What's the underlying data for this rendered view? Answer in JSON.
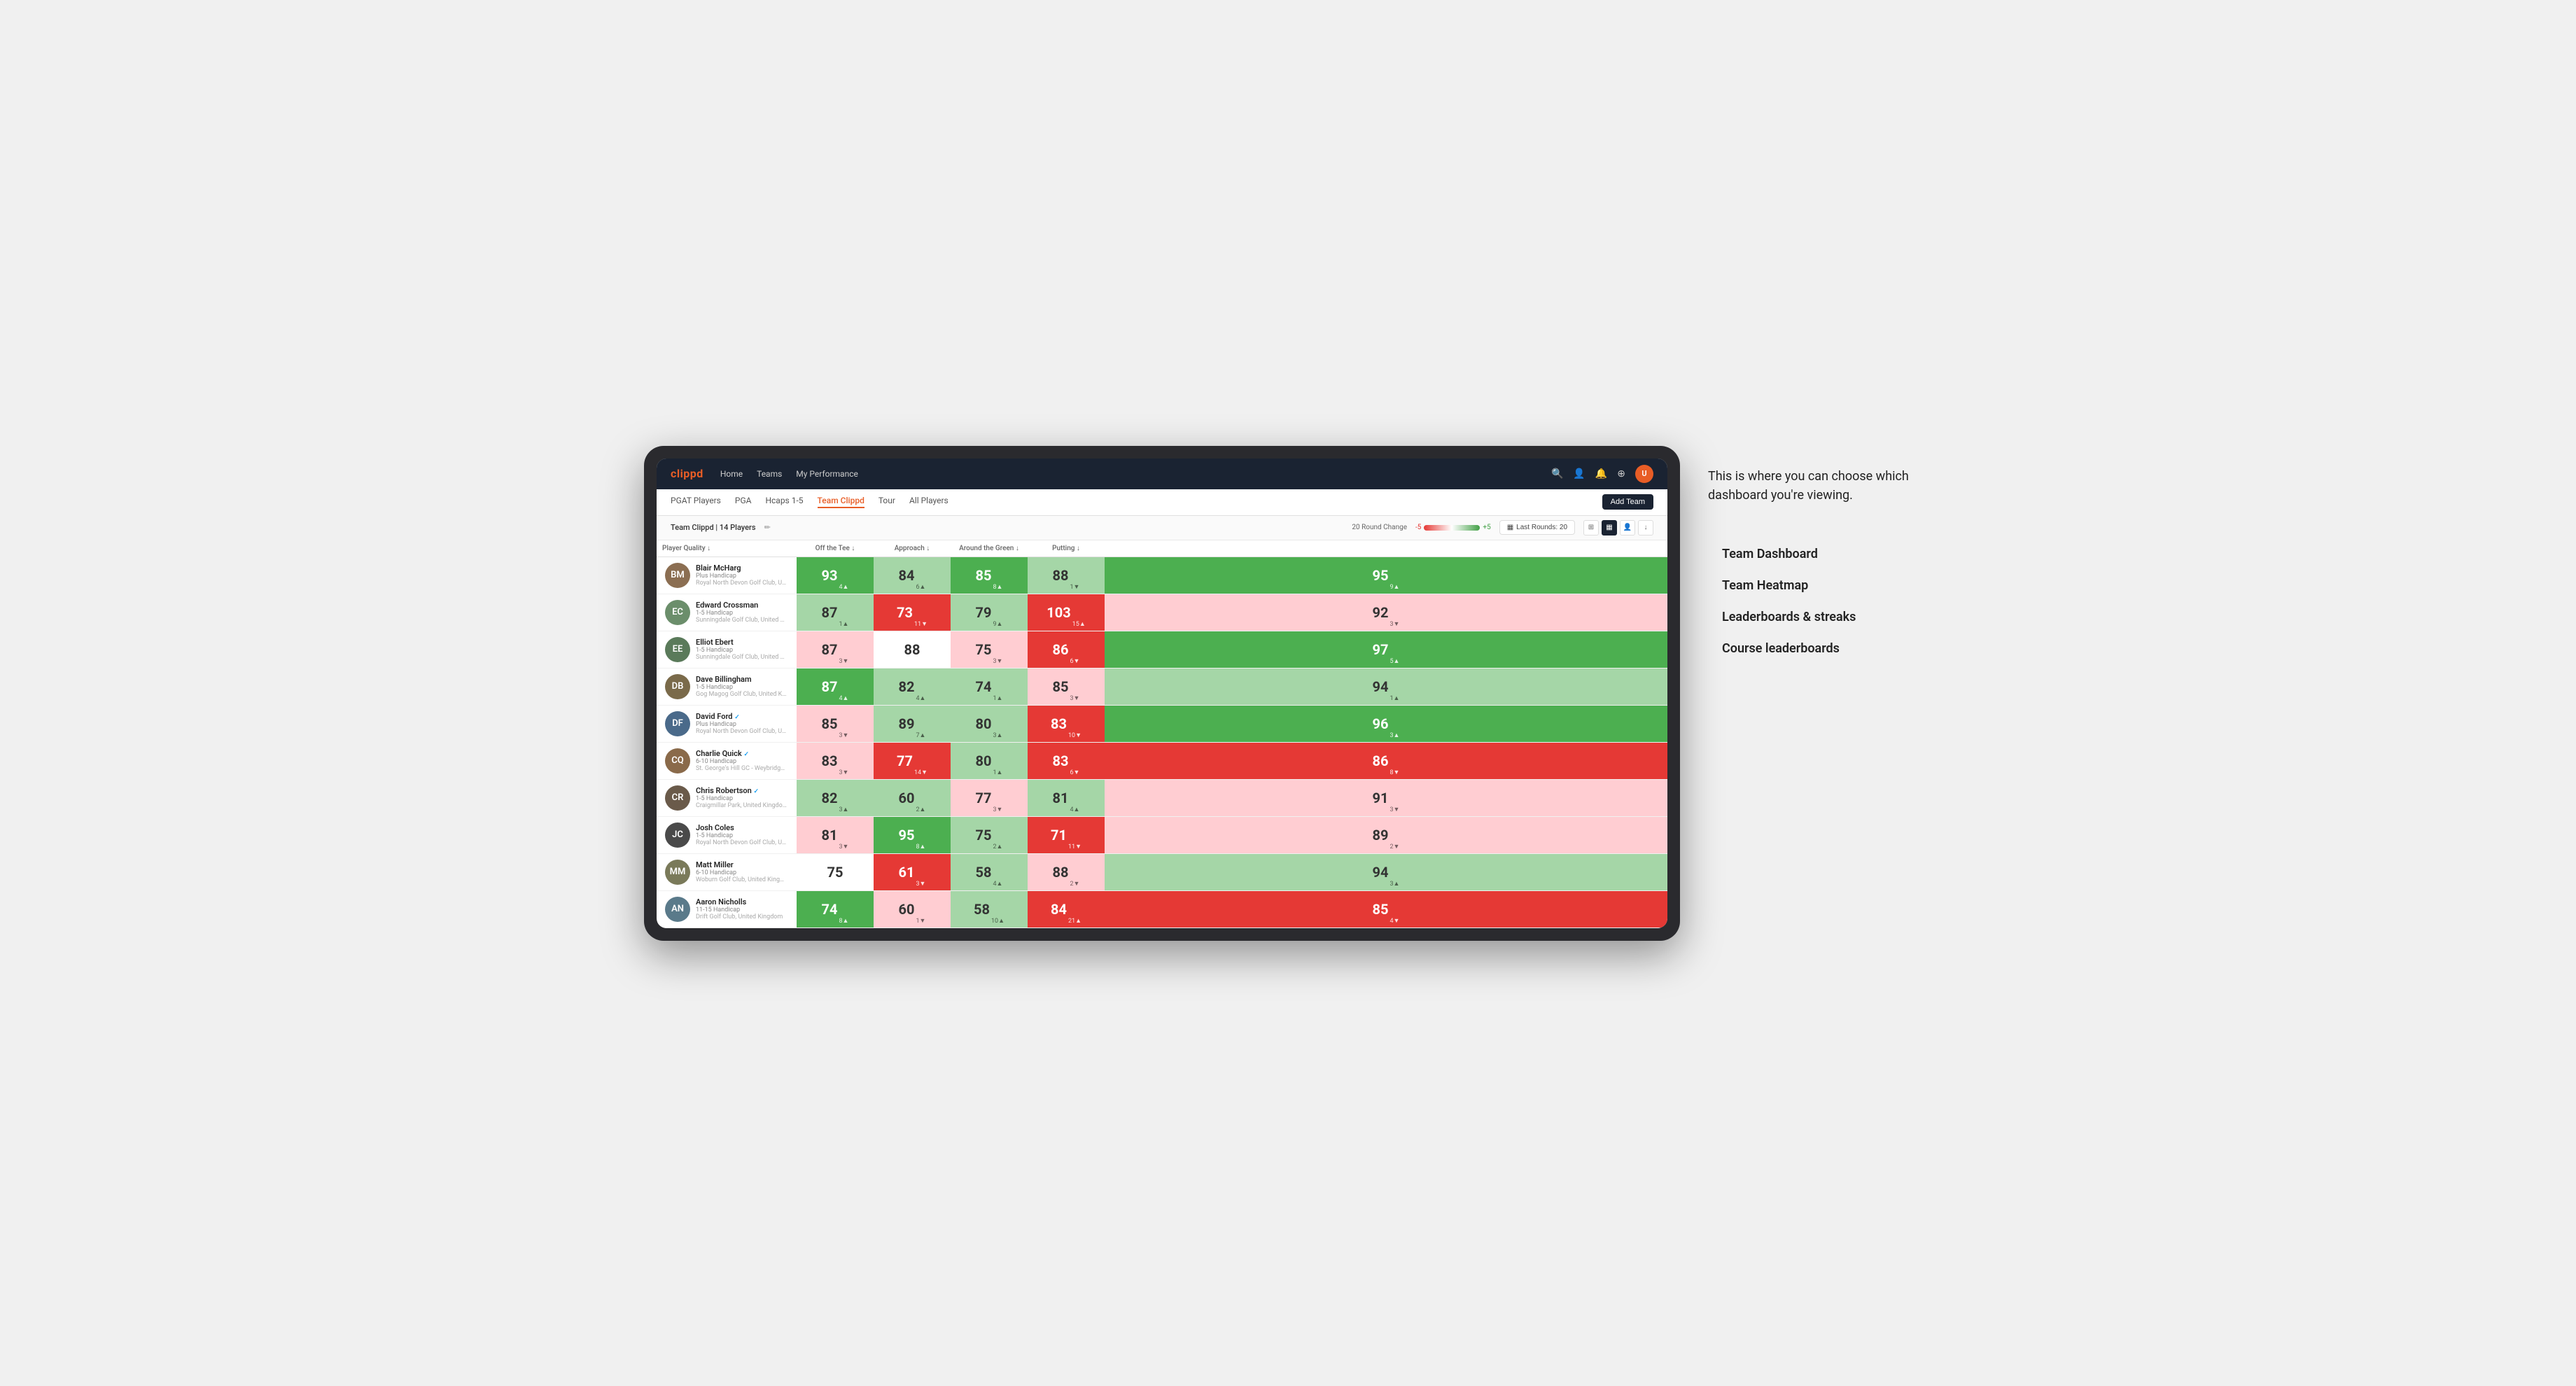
{
  "annotation": {
    "title": "This is where you can choose which dashboard you're viewing.",
    "arrow_note": "→",
    "options": [
      "Team Dashboard",
      "Team Heatmap",
      "Leaderboards & streaks",
      "Course leaderboards"
    ]
  },
  "nav": {
    "logo": "clippd",
    "links": [
      "Home",
      "Teams",
      "My Performance"
    ],
    "icons": [
      "search",
      "person",
      "bell",
      "circle-plus",
      "avatar"
    ]
  },
  "sub_tabs": {
    "tabs": [
      "PGAT Players",
      "PGA",
      "Hcaps 1-5",
      "Team Clippd",
      "Tour",
      "All Players"
    ],
    "active": "Team Clippd",
    "add_team_label": "Add Team"
  },
  "team_bar": {
    "label": "Team Clippd | 14 Players",
    "round_change_label": "20 Round Change",
    "scale_neg": "-5",
    "scale_pos": "+5",
    "last_rounds_label": "Last Rounds: 20",
    "view_icons": [
      "grid-large",
      "grid-small",
      "heatmap",
      "download"
    ]
  },
  "table": {
    "columns": [
      {
        "key": "player",
        "label": "Player Quality ↓"
      },
      {
        "key": "off_tee",
        "label": "Off the Tee ↓"
      },
      {
        "key": "approach",
        "label": "Approach ↓"
      },
      {
        "key": "around_green",
        "label": "Around the Green ↓"
      },
      {
        "key": "putting",
        "label": "Putting ↓"
      }
    ],
    "rows": [
      {
        "name": "Blair McHarg",
        "handicap": "Plus Handicap",
        "club": "Royal North Devon Golf Club, United Kingdom",
        "avatar_color": "#8B6E52",
        "initials": "BM",
        "player_quality": {
          "value": "93",
          "delta": "4",
          "dir": "up",
          "color": "green"
        },
        "off_tee": {
          "value": "84",
          "delta": "6",
          "dir": "up",
          "color": "light-green"
        },
        "approach": {
          "value": "85",
          "delta": "8",
          "dir": "up",
          "color": "green"
        },
        "around_green": {
          "value": "88",
          "delta": "1",
          "dir": "down",
          "color": "light-green"
        },
        "putting": {
          "value": "95",
          "delta": "9",
          "dir": "up",
          "color": "green"
        }
      },
      {
        "name": "Edward Crossman",
        "handicap": "1-5 Handicap",
        "club": "Sunningdale Golf Club, United Kingdom",
        "avatar_color": "#6B8E6B",
        "initials": "EC",
        "player_quality": {
          "value": "87",
          "delta": "1",
          "dir": "up",
          "color": "light-green"
        },
        "off_tee": {
          "value": "73",
          "delta": "11",
          "dir": "down",
          "color": "red"
        },
        "approach": {
          "value": "79",
          "delta": "9",
          "dir": "up",
          "color": "light-green"
        },
        "around_green": {
          "value": "103",
          "delta": "15",
          "dir": "up",
          "color": "red"
        },
        "putting": {
          "value": "92",
          "delta": "3",
          "dir": "down",
          "color": "light-red"
        }
      },
      {
        "name": "Elliot Ebert",
        "handicap": "1-5 Handicap",
        "club": "Sunningdale Golf Club, United Kingdom",
        "avatar_color": "#5a7a5a",
        "initials": "EE",
        "player_quality": {
          "value": "87",
          "delta": "3",
          "dir": "down",
          "color": "light-red"
        },
        "off_tee": {
          "value": "88",
          "delta": "",
          "dir": "",
          "color": "white"
        },
        "approach": {
          "value": "75",
          "delta": "3",
          "dir": "down",
          "color": "light-red"
        },
        "around_green": {
          "value": "86",
          "delta": "6",
          "dir": "down",
          "color": "red"
        },
        "putting": {
          "value": "97",
          "delta": "5",
          "dir": "up",
          "color": "green"
        }
      },
      {
        "name": "Dave Billingham",
        "handicap": "1-5 Handicap",
        "club": "Gog Magog Golf Club, United Kingdom",
        "avatar_color": "#7a6a4a",
        "initials": "DB",
        "player_quality": {
          "value": "87",
          "delta": "4",
          "dir": "up",
          "color": "green"
        },
        "off_tee": {
          "value": "82",
          "delta": "4",
          "dir": "up",
          "color": "light-green"
        },
        "approach": {
          "value": "74",
          "delta": "1",
          "dir": "up",
          "color": "light-green"
        },
        "around_green": {
          "value": "85",
          "delta": "3",
          "dir": "down",
          "color": "light-red"
        },
        "putting": {
          "value": "94",
          "delta": "1",
          "dir": "up",
          "color": "light-green"
        }
      },
      {
        "name": "David Ford",
        "handicap": "Plus Handicap",
        "club": "Royal North Devon Golf Club, United Kingdom",
        "avatar_color": "#4a6a8a",
        "initials": "DF",
        "verified": true,
        "player_quality": {
          "value": "85",
          "delta": "3",
          "dir": "down",
          "color": "light-red"
        },
        "off_tee": {
          "value": "89",
          "delta": "7",
          "dir": "up",
          "color": "light-green"
        },
        "approach": {
          "value": "80",
          "delta": "3",
          "dir": "up",
          "color": "light-green"
        },
        "around_green": {
          "value": "83",
          "delta": "10",
          "dir": "down",
          "color": "red"
        },
        "putting": {
          "value": "96",
          "delta": "3",
          "dir": "up",
          "color": "green"
        }
      },
      {
        "name": "Charlie Quick",
        "handicap": "6-10 Handicap",
        "club": "St. George's Hill GC - Weybridge - Surrey, Uni...",
        "avatar_color": "#8a6a4a",
        "initials": "CQ",
        "verified": true,
        "player_quality": {
          "value": "83",
          "delta": "3",
          "dir": "down",
          "color": "light-red"
        },
        "off_tee": {
          "value": "77",
          "delta": "14",
          "dir": "down",
          "color": "red"
        },
        "approach": {
          "value": "80",
          "delta": "1",
          "dir": "up",
          "color": "light-green"
        },
        "around_green": {
          "value": "83",
          "delta": "6",
          "dir": "down",
          "color": "red"
        },
        "putting": {
          "value": "86",
          "delta": "8",
          "dir": "down",
          "color": "red"
        }
      },
      {
        "name": "Chris Robertson",
        "handicap": "1-5 Handicap",
        "club": "Craigmillar Park, United Kingdom",
        "avatar_color": "#6a5a4a",
        "initials": "CR",
        "verified": true,
        "player_quality": {
          "value": "82",
          "delta": "3",
          "dir": "up",
          "color": "light-green"
        },
        "off_tee": {
          "value": "60",
          "delta": "2",
          "dir": "up",
          "color": "light-green"
        },
        "approach": {
          "value": "77",
          "delta": "3",
          "dir": "down",
          "color": "light-red"
        },
        "around_green": {
          "value": "81",
          "delta": "4",
          "dir": "up",
          "color": "light-green"
        },
        "putting": {
          "value": "91",
          "delta": "3",
          "dir": "down",
          "color": "light-red"
        }
      },
      {
        "name": "Josh Coles",
        "handicap": "1-5 Handicap",
        "club": "Royal North Devon Golf Club, United Kingdom",
        "avatar_color": "#4a4a4a",
        "initials": "JC",
        "player_quality": {
          "value": "81",
          "delta": "3",
          "dir": "down",
          "color": "light-red"
        },
        "off_tee": {
          "value": "95",
          "delta": "8",
          "dir": "up",
          "color": "green"
        },
        "approach": {
          "value": "75",
          "delta": "2",
          "dir": "up",
          "color": "light-green"
        },
        "around_green": {
          "value": "71",
          "delta": "11",
          "dir": "down",
          "color": "red"
        },
        "putting": {
          "value": "89",
          "delta": "2",
          "dir": "down",
          "color": "light-red"
        }
      },
      {
        "name": "Matt Miller",
        "handicap": "6-10 Handicap",
        "club": "Woburn Golf Club, United Kingdom",
        "avatar_color": "#7a7a5a",
        "initials": "MM",
        "player_quality": {
          "value": "75",
          "delta": "",
          "dir": "",
          "color": "white"
        },
        "off_tee": {
          "value": "61",
          "delta": "3",
          "dir": "down",
          "color": "red"
        },
        "approach": {
          "value": "58",
          "delta": "4",
          "dir": "up",
          "color": "light-green"
        },
        "around_green": {
          "value": "88",
          "delta": "2",
          "dir": "down",
          "color": "light-red"
        },
        "putting": {
          "value": "94",
          "delta": "3",
          "dir": "up",
          "color": "light-green"
        }
      },
      {
        "name": "Aaron Nicholls",
        "handicap": "11-15 Handicap",
        "club": "Drift Golf Club, United Kingdom",
        "avatar_color": "#5a7a8a",
        "initials": "AN",
        "player_quality": {
          "value": "74",
          "delta": "8",
          "dir": "up",
          "color": "green"
        },
        "off_tee": {
          "value": "60",
          "delta": "1",
          "dir": "down",
          "color": "light-red"
        },
        "approach": {
          "value": "58",
          "delta": "10",
          "dir": "up",
          "color": "light-green"
        },
        "around_green": {
          "value": "84",
          "delta": "21",
          "dir": "up",
          "color": "red"
        },
        "putting": {
          "value": "85",
          "delta": "4",
          "dir": "down",
          "color": "red"
        }
      }
    ]
  },
  "sidebar": {
    "annotation_title": "This is where you can choose which dashboard you're viewing.",
    "options": [
      "Team Dashboard",
      "Team Heatmap",
      "Leaderboards & streaks",
      "Course leaderboards"
    ]
  }
}
